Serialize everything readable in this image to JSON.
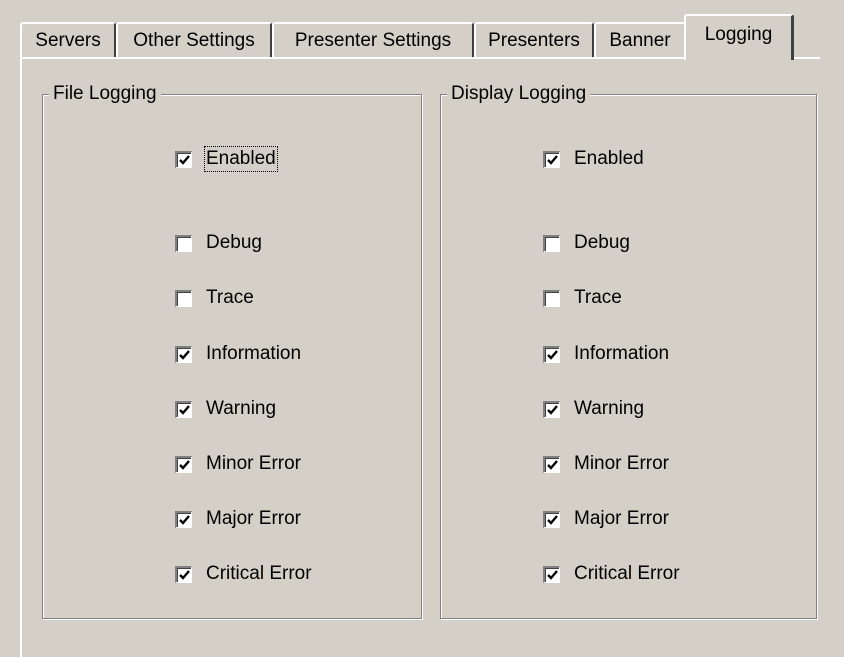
{
  "tabs": [
    {
      "label": "Servers",
      "active": false
    },
    {
      "label": "Other Settings",
      "active": false
    },
    {
      "label": "Presenter Settings",
      "active": false
    },
    {
      "label": "Presenters",
      "active": false
    },
    {
      "label": "Banner",
      "active": false
    },
    {
      "label": "Logging",
      "active": true
    }
  ],
  "groups": [
    {
      "title": "File Logging",
      "options": [
        {
          "label": "Enabled",
          "checked": true,
          "focused": true
        },
        {
          "label": "Debug",
          "checked": false
        },
        {
          "label": "Trace",
          "checked": false
        },
        {
          "label": "Information",
          "checked": true
        },
        {
          "label": "Warning",
          "checked": true
        },
        {
          "label": "Minor Error",
          "checked": true
        },
        {
          "label": "Major Error",
          "checked": true
        },
        {
          "label": "Critical Error",
          "checked": true
        }
      ]
    },
    {
      "title": "Display Logging",
      "options": [
        {
          "label": "Enabled",
          "checked": true
        },
        {
          "label": "Debug",
          "checked": false
        },
        {
          "label": "Trace",
          "checked": false
        },
        {
          "label": "Information",
          "checked": true
        },
        {
          "label": "Warning",
          "checked": true
        },
        {
          "label": "Minor Error",
          "checked": true
        },
        {
          "label": "Major Error",
          "checked": true
        },
        {
          "label": "Critical Error",
          "checked": true
        }
      ]
    }
  ]
}
